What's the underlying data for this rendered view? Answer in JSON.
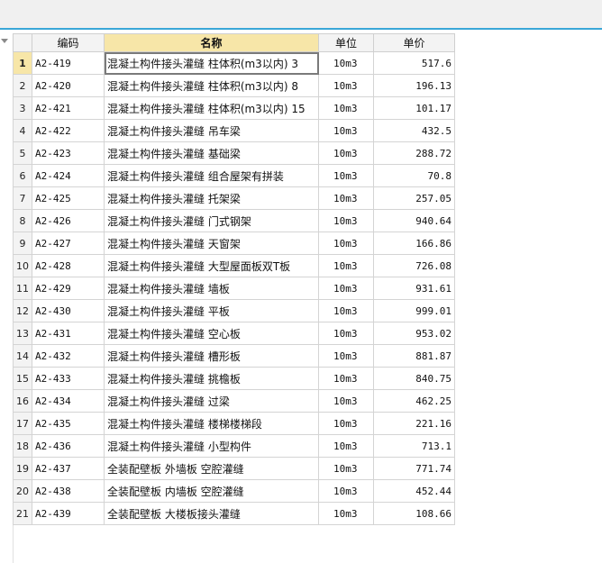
{
  "header": {
    "code": "编码",
    "name": "名称",
    "unit": "单位",
    "price": "单价"
  },
  "rows": [
    {
      "n": "1",
      "code": "A2-419",
      "name": "混凝土构件接头灌缝 柱体积(m3以内) 3",
      "unit": "10m3",
      "price": "517.6"
    },
    {
      "n": "2",
      "code": "A2-420",
      "name": "混凝土构件接头灌缝 柱体积(m3以内) 8",
      "unit": "10m3",
      "price": "196.13"
    },
    {
      "n": "3",
      "code": "A2-421",
      "name": "混凝土构件接头灌缝 柱体积(m3以内) 15",
      "unit": "10m3",
      "price": "101.17"
    },
    {
      "n": "4",
      "code": "A2-422",
      "name": "混凝土构件接头灌缝 吊车梁",
      "unit": "10m3",
      "price": "432.5"
    },
    {
      "n": "5",
      "code": "A2-423",
      "name": "混凝土构件接头灌缝 基础梁",
      "unit": "10m3",
      "price": "288.72"
    },
    {
      "n": "6",
      "code": "A2-424",
      "name": "混凝土构件接头灌缝 组合屋架有拼装",
      "unit": "10m3",
      "price": "70.8"
    },
    {
      "n": "7",
      "code": "A2-425",
      "name": "混凝土构件接头灌缝 托架梁",
      "unit": "10m3",
      "price": "257.05"
    },
    {
      "n": "8",
      "code": "A2-426",
      "name": "混凝土构件接头灌缝 门式钢架",
      "unit": "10m3",
      "price": "940.64"
    },
    {
      "n": "9",
      "code": "A2-427",
      "name": "混凝土构件接头灌缝 天窗架",
      "unit": "10m3",
      "price": "166.86"
    },
    {
      "n": "10",
      "code": "A2-428",
      "name": "混凝土构件接头灌缝 大型屋面板双T板",
      "unit": "10m3",
      "price": "726.08"
    },
    {
      "n": "11",
      "code": "A2-429",
      "name": "混凝土构件接头灌缝 墙板",
      "unit": "10m3",
      "price": "931.61"
    },
    {
      "n": "12",
      "code": "A2-430",
      "name": "混凝土构件接头灌缝 平板",
      "unit": "10m3",
      "price": "999.01"
    },
    {
      "n": "13",
      "code": "A2-431",
      "name": "混凝土构件接头灌缝 空心板",
      "unit": "10m3",
      "price": "953.02"
    },
    {
      "n": "14",
      "code": "A2-432",
      "name": "混凝土构件接头灌缝 槽形板",
      "unit": "10m3",
      "price": "881.87"
    },
    {
      "n": "15",
      "code": "A2-433",
      "name": "混凝土构件接头灌缝 挑檐板",
      "unit": "10m3",
      "price": "840.75"
    },
    {
      "n": "16",
      "code": "A2-434",
      "name": "混凝土构件接头灌缝 过梁",
      "unit": "10m3",
      "price": "462.25"
    },
    {
      "n": "17",
      "code": "A2-435",
      "name": "混凝土构件接头灌缝 楼梯楼梯段",
      "unit": "10m3",
      "price": "221.16"
    },
    {
      "n": "18",
      "code": "A2-436",
      "name": "混凝土构件接头灌缝 小型构件",
      "unit": "10m3",
      "price": "713.1"
    },
    {
      "n": "19",
      "code": "A2-437",
      "name": "全装配壁板 外墙板 空腔灌缝",
      "unit": "10m3",
      "price": "771.74"
    },
    {
      "n": "20",
      "code": "A2-438",
      "name": "全装配壁板 内墙板 空腔灌缝",
      "unit": "10m3",
      "price": "452.44"
    },
    {
      "n": "21",
      "code": "A2-439",
      "name": "全装配壁板 大楼板接头灌缝",
      "unit": "10m3",
      "price": "108.66"
    }
  ],
  "active_row": "1",
  "colors": {
    "accent": "#3aa7d8",
    "sorted_header": "#f7e6a8"
  }
}
